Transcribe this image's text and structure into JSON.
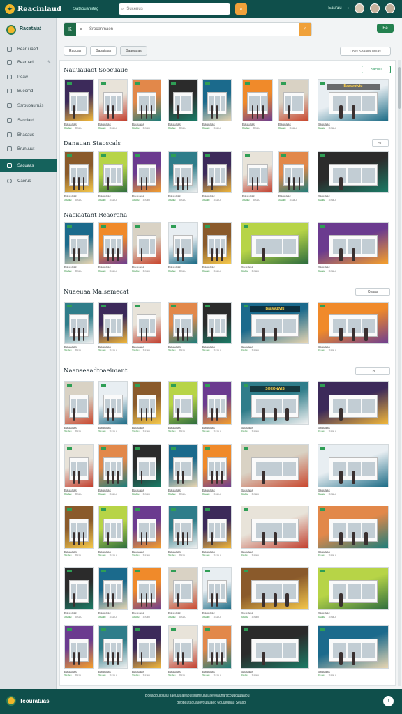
{
  "header": {
    "brand": "Reacinlaud",
    "links": "Satsouaniitag",
    "search_placeholder": "Sucenus",
    "lang": "Eaurau",
    "logo_icon": "storefront-logo-icon",
    "search_icon": "search-icon"
  },
  "sidebar": {
    "title": "Racataiat",
    "items": [
      {
        "label": "Bearuuaed",
        "icon": "home-icon"
      },
      {
        "label": "Bearuad",
        "icon": "store-icon"
      },
      {
        "label": "Poaw",
        "icon": "box-icon"
      },
      {
        "label": "Bueomd",
        "icon": "chart-icon"
      },
      {
        "label": "Ssrpuoaurruis",
        "icon": "grid-icon"
      },
      {
        "label": "Sacolard",
        "icon": "tag-icon"
      },
      {
        "label": "Bhaoaus",
        "icon": "list-icon"
      },
      {
        "label": "Brunuuut",
        "icon": "user-icon"
      },
      {
        "label": "Sacuaas",
        "icon": "folder-icon"
      },
      {
        "label": "Caorus",
        "icon": "gear-icon"
      }
    ],
    "active_index": 8
  },
  "main": {
    "search_placeholder": "Srocanmaon",
    "go_label": "K",
    "top_button": "Ee",
    "tabs": [
      "Rauuas",
      "Baoaiiaas",
      "Baaoauas"
    ],
    "filter_label": "Cous Soaaiiauiauas"
  },
  "sections": [
    {
      "title": "Nauuauaot Soocuaue",
      "button": "Sacuiu"
    },
    {
      "title": "Danauan Staoscals",
      "button": "Su"
    },
    {
      "title": "Naciaatant Rcaorana",
      "button": ""
    },
    {
      "title": "Nuaeuaa Malsemecat",
      "button": "Coaas"
    },
    {
      "title": "Naanseaadtoaeimant",
      "button": "Co"
    }
  ],
  "card_label": "Bauuaas",
  "card_price": "Suau",
  "card_meta": "Ssau",
  "promo_banner": "Baavvutvtu",
  "hero_title": "Baauvaane",
  "hero_headline": "SOEONWIS",
  "footer": {
    "brand": "Teouratuas",
    "links": "Bdeacioucsuiiu Taeuuiuaeaouisuaneuaauaeyoaunarscouucuuaaiou",
    "links2": "Beopautaouasovouauaeo 6ouueunau Seaso",
    "help_icon": "info-icon"
  },
  "colors": {
    "primary": "#0f4f4b",
    "accent": "#f0a13a",
    "green": "#23814f",
    "sidebar_active": "#15625c"
  }
}
